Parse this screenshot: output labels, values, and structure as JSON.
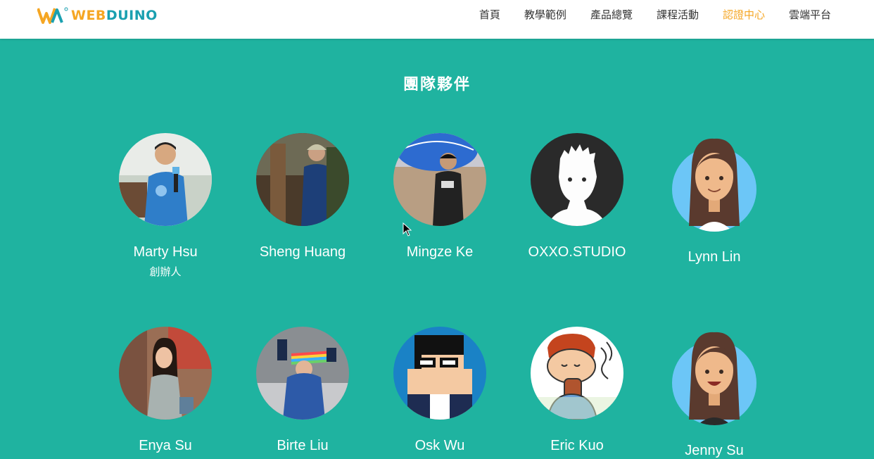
{
  "header": {
    "logo_text_web": "WEB",
    "logo_text_duino": "DUINO",
    "nav": [
      "首頁",
      "教學範例",
      "產品總覽",
      "課程活動",
      "認證中心",
      "雲端平台"
    ],
    "active_nav": "認證中心",
    "colors": {
      "accent": "#f5a623",
      "brand_teal": "#1aa0b0"
    }
  },
  "section": {
    "title": "團隊夥伴",
    "background": "#1fb3a0"
  },
  "members": [
    {
      "name": "Marty Hsu",
      "role": "創辦人",
      "avatar": "photo-man-microphone-icon"
    },
    {
      "name": "Sheng Huang",
      "role": "",
      "avatar": "photo-man-forest-icon"
    },
    {
      "name": "Mingze Ke",
      "role": "",
      "avatar": "photo-man-balloon-icon"
    },
    {
      "name": "OXXO.STUDIO",
      "role": "",
      "avatar": "cartoon-silhouette-icon"
    },
    {
      "name": "Lynn Lin",
      "role": "",
      "avatar": "cartoon-woman-icon"
    },
    {
      "name": "Enya Su",
      "role": "",
      "avatar": "photo-woman-market-icon"
    },
    {
      "name": "Birte Liu",
      "role": "",
      "avatar": "photo-woman-scarf-icon"
    },
    {
      "name": "Osk Wu",
      "role": "",
      "avatar": "pixel-man-glasses-icon"
    },
    {
      "name": "Eric Kuo",
      "role": "",
      "avatar": "cartoon-boy-drinking-icon"
    },
    {
      "name": "Jenny Su",
      "role": "",
      "avatar": "cartoon-woman-smiling-icon"
    }
  ]
}
